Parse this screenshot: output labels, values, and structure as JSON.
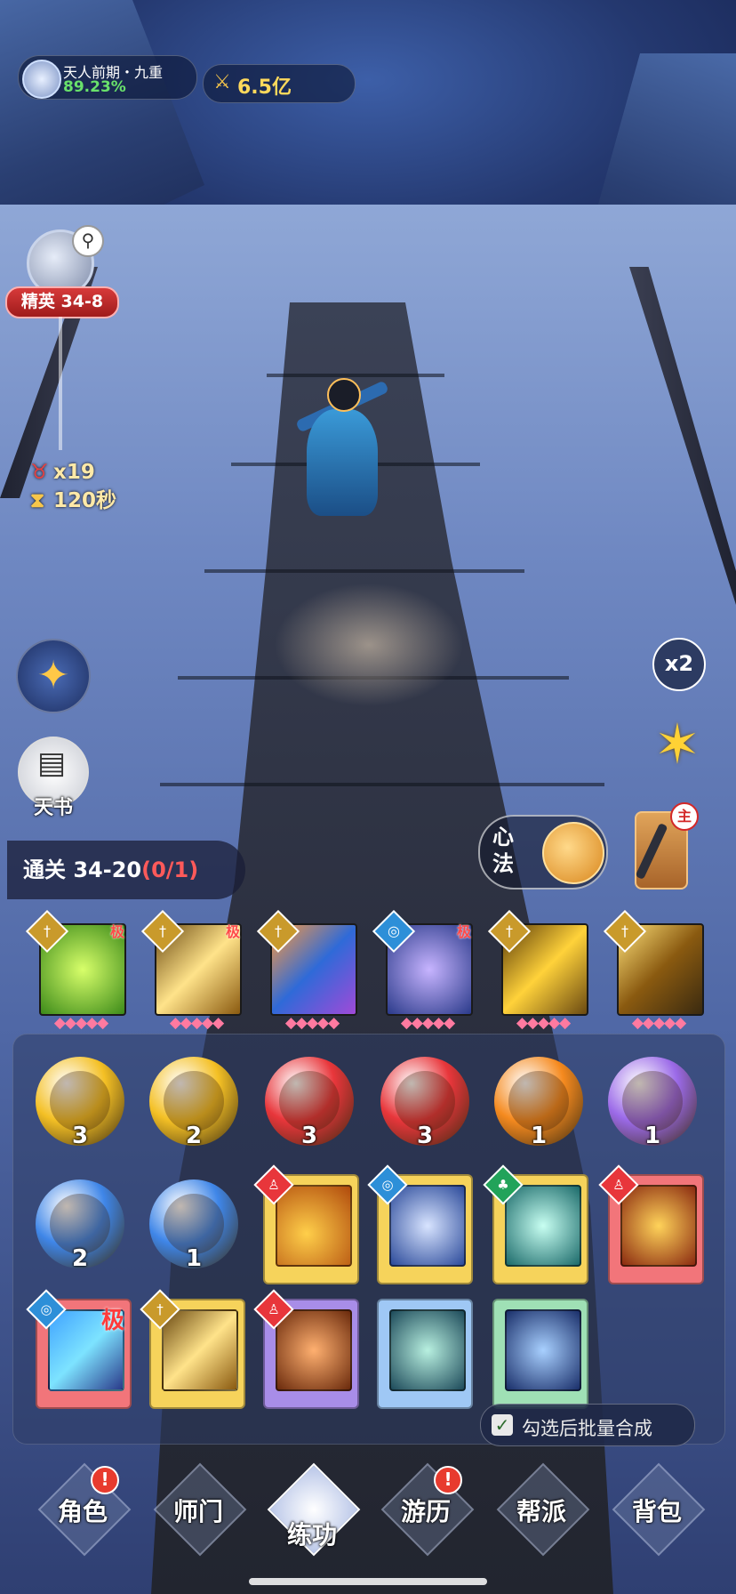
{
  "hud": {
    "realm_title": "天人前期・九重",
    "realm_percent": "89.23%",
    "combat_power": "6.5亿"
  },
  "stage": {
    "label": "精英 34-8",
    "kill_count": "x19",
    "time_left": "120秒"
  },
  "side_buttons": {
    "tianshu_label": "天书",
    "speed_label": "x2",
    "xinfa_label": "心法",
    "weapon_badge": "主"
  },
  "clear_progress": {
    "label": "通关 34-20",
    "progress": "(0/1)"
  },
  "equipped_cards": [
    {
      "type_icon": "sword-icon",
      "ji": "极",
      "stars": 5
    },
    {
      "type_icon": "sword-icon",
      "ji": "极",
      "stars": 5
    },
    {
      "type_icon": "sword-icon",
      "ji": "",
      "stars": 5
    },
    {
      "type_icon": "swirl-icon",
      "ji": "极",
      "stars": 5
    },
    {
      "type_icon": "sword-icon",
      "ji": "",
      "stars": 5
    },
    {
      "type_icon": "sword-icon",
      "ji": "",
      "stars": 5
    }
  ],
  "orbs": [
    {
      "color": "#f4c025",
      "count": "3"
    },
    {
      "color": "#f4c025",
      "count": "2"
    },
    {
      "color": "#e8363b",
      "count": "3"
    },
    {
      "color": "#e8363b",
      "count": "3"
    },
    {
      "color": "#f58a1f",
      "count": "1"
    },
    {
      "color": "#9b6ae8",
      "count": "1"
    },
    {
      "color": "#3f86e8",
      "count": "2"
    },
    {
      "color": "#3f86e8",
      "count": "1"
    }
  ],
  "books": [
    {
      "frame": "#f6d35b",
      "type_color": "#e8363b",
      "type_icon": "person-icon",
      "ji": ""
    },
    {
      "frame": "#f6d35b",
      "type_color": "#2d8fd8",
      "type_icon": "swirl-icon",
      "ji": ""
    },
    {
      "frame": "#f6d35b",
      "type_color": "#22a35a",
      "type_icon": "leaf-icon",
      "ji": ""
    },
    {
      "frame": "#f2757a",
      "type_color": "#e8363b",
      "type_icon": "person-icon",
      "ji": ""
    },
    {
      "frame": "#f2757a",
      "type_color": "#2d8fd8",
      "type_icon": "swirl-icon",
      "ji": "极"
    },
    {
      "frame": "#f6d35b",
      "type_color": "#c99a2b",
      "type_icon": "sword-icon",
      "ji": ""
    },
    {
      "frame": "#a88de8",
      "type_color": "#e8363b",
      "type_icon": "person-icon",
      "ji": ""
    },
    {
      "frame": "#9fc8f5",
      "type_color": "",
      "type_icon": "",
      "ji": ""
    },
    {
      "frame": "#9fe0b5",
      "type_color": "",
      "type_icon": "",
      "ji": ""
    }
  ],
  "batch_merge_label": "勾选后批量合成",
  "nav": [
    {
      "label": "角色",
      "alert": "!",
      "active": false
    },
    {
      "label": "师门",
      "alert": "",
      "active": false
    },
    {
      "label": "练功",
      "alert": "",
      "active": true
    },
    {
      "label": "游历",
      "alert": "!",
      "active": false
    },
    {
      "label": "帮派",
      "alert": "",
      "active": false
    },
    {
      "label": "背包",
      "alert": "",
      "active": false
    }
  ]
}
